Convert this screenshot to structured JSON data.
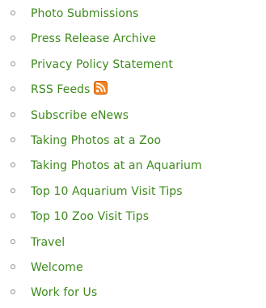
{
  "links": [
    {
      "label": "Photo Submissions"
    },
    {
      "label": "Press Release Archive"
    },
    {
      "label": "Privacy Policy Statement"
    },
    {
      "label": "RSS Feeds",
      "icon": "rss-feed-icon"
    },
    {
      "label": "Subscribe eNews"
    },
    {
      "label": "Taking Photos at a Zoo"
    },
    {
      "label": "Taking Photos at an Aquarium"
    },
    {
      "label": "Top 10 Aquarium Visit Tips"
    },
    {
      "label": "Top 10 Zoo Visit Tips"
    },
    {
      "label": "Travel"
    },
    {
      "label": "Welcome"
    },
    {
      "label": "Work for Us"
    }
  ],
  "colors": {
    "link": "#3e8a1d",
    "bullet": "#8c8c8c",
    "rss_icon": "#f58220"
  }
}
